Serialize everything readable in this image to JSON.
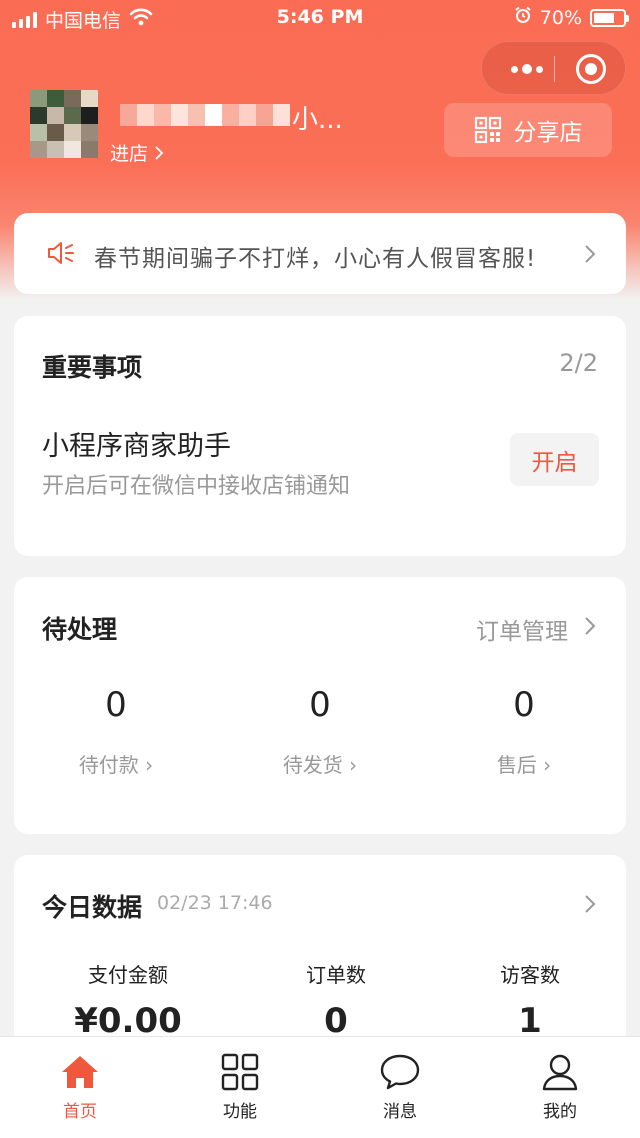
{
  "status_bar": {
    "carrier": "中国电信",
    "time": "5:46 PM",
    "battery": "70%",
    "battery_level": 0.7
  },
  "shop": {
    "name": "小...",
    "enter_label": "进店",
    "share_label": "分享店"
  },
  "notice": {
    "text": "春节期间骗子不打烊，小心有人假冒客服!"
  },
  "important": {
    "title": "重要事项",
    "count": "2/2",
    "item_title": "小程序商家助手",
    "item_subtitle": "开启后可在微信中接收店铺通知",
    "button_label": "开启"
  },
  "pending": {
    "title": "待处理",
    "link_label": "订单管理",
    "stats": [
      {
        "value": "0",
        "label": "待付款"
      },
      {
        "value": "0",
        "label": "待发货"
      },
      {
        "value": "0",
        "label": "售后"
      }
    ]
  },
  "today": {
    "title": "今日数据",
    "date": "02/23 17:46",
    "stats": [
      {
        "label": "支付金额",
        "value": "¥0.00"
      },
      {
        "label": "订单数",
        "value": "0"
      },
      {
        "label": "访客数",
        "value": "1"
      }
    ]
  },
  "tabbar": {
    "items": [
      {
        "label": "首页",
        "icon": "home-icon",
        "active": true
      },
      {
        "label": "功能",
        "icon": "grid-icon",
        "active": false
      },
      {
        "label": "消息",
        "icon": "chat-bubble-icon",
        "active": false
      },
      {
        "label": "我的",
        "icon": "user-icon",
        "active": false
      }
    ]
  },
  "colors": {
    "accent": "#f0583e",
    "header": "#fb6c54"
  }
}
